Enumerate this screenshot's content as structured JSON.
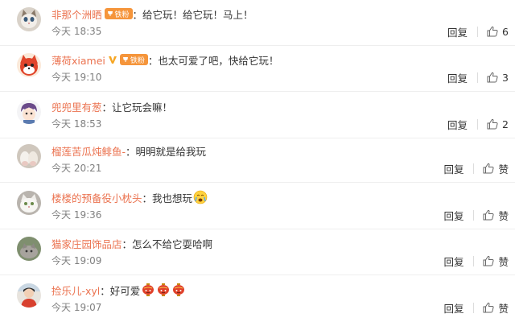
{
  "colors": {
    "username": "#eb7350",
    "time": "#808080",
    "text": "#333333",
    "fan_badge": "#f5953b"
  },
  "comments": [
    {
      "user": "非那个洲晒",
      "sep": "：",
      "text": "给它玩！给它玩！马上！",
      "time": "今天 18:35",
      "reply": "回复",
      "like": "6",
      "badges": {
        "vip": false,
        "fan": true,
        "fan_label": "铁粉"
      },
      "avatar": "cat-avatar",
      "emojis": []
    },
    {
      "user": "薄荷xiamei",
      "sep": "：",
      "text": "也太可爱了吧，快给它玩！",
      "time": "今天 19:10",
      "reply": "回复",
      "like": "3",
      "badges": {
        "vip": true,
        "fan": true,
        "fan_label": "铁粉"
      },
      "avatar": "red-cartoon-avatar",
      "emojis": []
    },
    {
      "user": "兜兜里有葱",
      "sep": "：",
      "text": "让它玩会嘛！",
      "time": "今天 18:53",
      "reply": "回复",
      "like": "2",
      "badges": {
        "vip": false,
        "fan": false
      },
      "avatar": "anime-boy-avatar",
      "emojis": []
    },
    {
      "user": "榴莲苦瓜炖鲱鱼-",
      "sep": "：",
      "text": "明明就是给我玩",
      "time": "今天 20:21",
      "reply": "回复",
      "like": "赞",
      "badges": {
        "vip": false,
        "fan": false
      },
      "avatar": "cat-paws-avatar",
      "emojis": []
    },
    {
      "user": "楼楼的预备役小枕头",
      "sep": "：",
      "text": "我也想玩",
      "time": "今天 19:36",
      "reply": "回复",
      "like": "赞",
      "badges": {
        "vip": false,
        "fan": false
      },
      "avatar": "white-cat-avatar",
      "emojis": [
        "crying-face-emoji"
      ]
    },
    {
      "user": "猫家庄园饰品店",
      "sep": "：",
      "text": "怎么不给它耍哈啊",
      "time": "今天 19:09",
      "reply": "回复",
      "like": "赞",
      "badges": {
        "vip": false,
        "fan": false
      },
      "avatar": "grey-cat-avatar",
      "emojis": []
    },
    {
      "user": "捡乐儿-xyl",
      "sep": "：",
      "text": "好可爱",
      "time": "今天 19:07",
      "reply": "回复",
      "like": "赞",
      "badges": {
        "vip": false,
        "fan": false
      },
      "avatar": "person-avatar",
      "emojis": [
        "lantern-emoji",
        "lantern-emoji",
        "lantern-emoji"
      ]
    }
  ]
}
